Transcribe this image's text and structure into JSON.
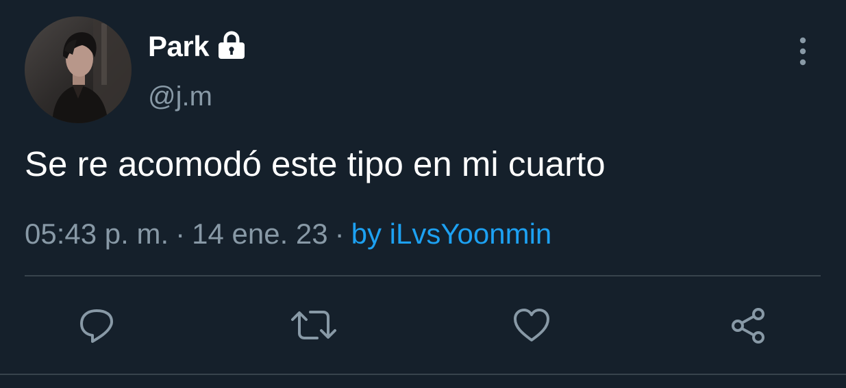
{
  "tweet": {
    "display_name": "Park",
    "handle": "@j.m",
    "text": "Se re acomodó este tipo en mi cuarto",
    "time": "05:43 p. m.",
    "date": "14 ene. 23",
    "separator": "·",
    "source": "by iLvsYoonmin",
    "protected_icon": "lock-icon",
    "menu_icon": "more-vertical-icon"
  },
  "actions": [
    {
      "icon": "reply-icon"
    },
    {
      "icon": "retweet-icon"
    },
    {
      "icon": "like-icon"
    },
    {
      "icon": "share-icon"
    }
  ],
  "colors": {
    "background": "#15202b",
    "primary_text": "#ffffff",
    "secondary_text": "#8899a6",
    "accent": "#1da1f2",
    "divider": "#38444d"
  }
}
